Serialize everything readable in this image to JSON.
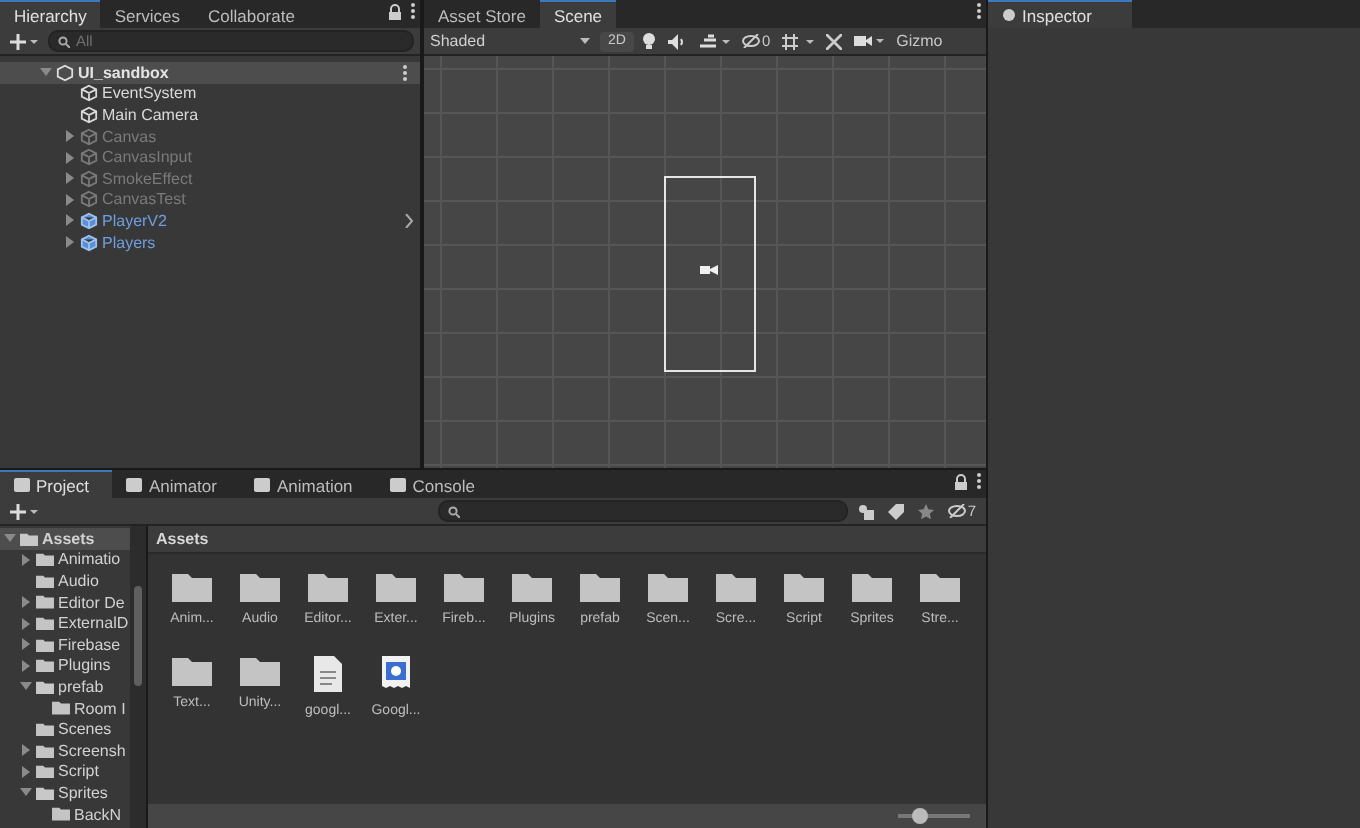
{
  "hierarchy": {
    "tabs": [
      {
        "label": "Hierarchy",
        "selected": true
      },
      {
        "label": "Services",
        "selected": false
      },
      {
        "label": "Collaborate",
        "selected": false
      }
    ],
    "search": {
      "placeholder": "All"
    },
    "scene": {
      "name": "UI_sandbox",
      "expanded": true,
      "children": [
        {
          "name": "EventSystem",
          "kind": "object",
          "disabled": false,
          "has_children": false
        },
        {
          "name": "Main Camera",
          "kind": "object",
          "disabled": false,
          "has_children": false
        },
        {
          "name": "Canvas",
          "kind": "object",
          "disabled": true,
          "has_children": true
        },
        {
          "name": "CanvasInput",
          "kind": "object",
          "disabled": true,
          "has_children": true
        },
        {
          "name": "SmokeEffect",
          "kind": "object",
          "disabled": true,
          "has_children": true
        },
        {
          "name": "CanvasTest",
          "kind": "object",
          "disabled": true,
          "has_children": true
        },
        {
          "name": "PlayerV2",
          "kind": "prefab",
          "disabled": false,
          "has_children": true
        },
        {
          "name": "Players",
          "kind": "prefab",
          "disabled": false,
          "has_children": true
        }
      ]
    }
  },
  "scene_view": {
    "tabs": [
      {
        "label": "Asset Store",
        "selected": false
      },
      {
        "label": "Scene",
        "selected": true
      }
    ],
    "shading": "Shaded",
    "mode_2d": "2D",
    "hidden_count": "0",
    "gizmos": "Gizmo"
  },
  "inspector": {
    "tabs": [
      {
        "label": "Inspector",
        "selected": true
      }
    ]
  },
  "project": {
    "tabs": [
      {
        "label": "Project",
        "selected": true
      },
      {
        "label": "Animator",
        "selected": false
      },
      {
        "label": "Animation",
        "selected": false
      },
      {
        "label": "Console",
        "selected": false
      }
    ],
    "hidden_count": "7",
    "tree": [
      {
        "name": "Assets",
        "expanded": true,
        "selected": true,
        "children": [
          {
            "name": "Animatio",
            "expanded": false,
            "has_children": true
          },
          {
            "name": "Audio",
            "expanded": false,
            "has_children": false
          },
          {
            "name": "Editor De",
            "expanded": false,
            "has_children": true
          },
          {
            "name": "ExternalD",
            "expanded": false,
            "has_children": true
          },
          {
            "name": "Firebase",
            "expanded": false,
            "has_children": true
          },
          {
            "name": "Plugins",
            "expanded": false,
            "has_children": true
          },
          {
            "name": "prefab",
            "expanded": true,
            "has_children": true,
            "children": [
              {
                "name": "Room I",
                "expanded": false,
                "has_children": false
              }
            ]
          },
          {
            "name": "Scenes",
            "expanded": false,
            "has_children": false
          },
          {
            "name": "Screensh",
            "expanded": false,
            "has_children": true
          },
          {
            "name": "Script",
            "expanded": false,
            "has_children": true
          },
          {
            "name": "Sprites",
            "expanded": true,
            "has_children": true,
            "children": [
              {
                "name": "BackN",
                "expanded": false,
                "has_children": false
              }
            ]
          }
        ]
      }
    ],
    "breadcrumb": "Assets",
    "items": [
      {
        "name": "Anim...",
        "kind": "folder"
      },
      {
        "name": "Audio",
        "kind": "folder"
      },
      {
        "name": "Editor...",
        "kind": "folder"
      },
      {
        "name": "Exter...",
        "kind": "folder"
      },
      {
        "name": "Fireb...",
        "kind": "folder"
      },
      {
        "name": "Plugins",
        "kind": "folder"
      },
      {
        "name": "prefab",
        "kind": "folder"
      },
      {
        "name": "Scen...",
        "kind": "folder"
      },
      {
        "name": "Scre...",
        "kind": "folder"
      },
      {
        "name": "Script",
        "kind": "folder"
      },
      {
        "name": "Sprites",
        "kind": "folder"
      },
      {
        "name": "Stre...",
        "kind": "folder"
      },
      {
        "name": "Text...",
        "kind": "folder"
      },
      {
        "name": "Unity...",
        "kind": "folder"
      },
      {
        "name": "googl...",
        "kind": "text"
      },
      {
        "name": "Googl...",
        "kind": "asset"
      }
    ],
    "zoom": {
      "level": 0.3
    }
  }
}
